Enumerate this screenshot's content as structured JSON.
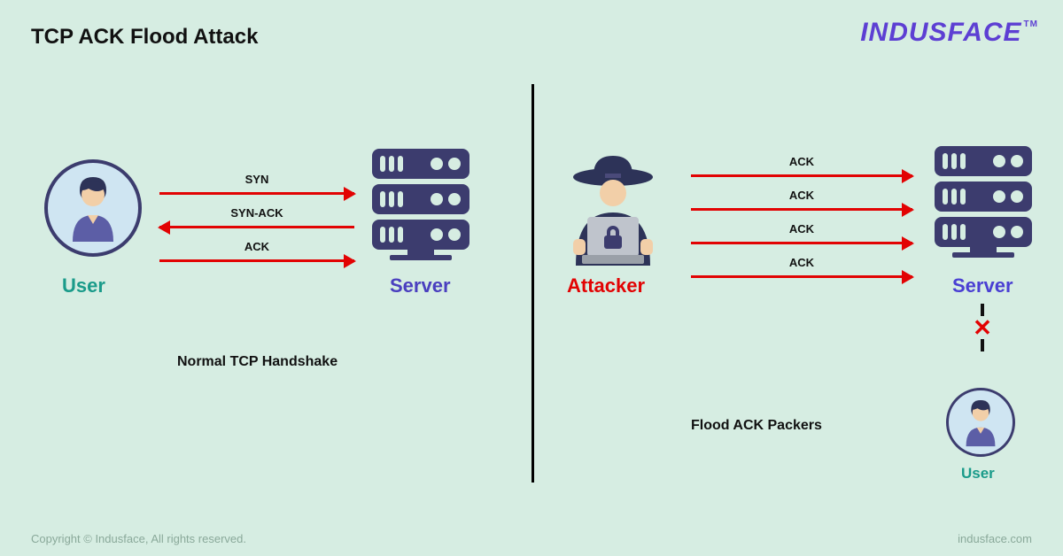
{
  "title": "TCP ACK Flood Attack",
  "brand": "INDUSFACE",
  "brand_tm": "TM",
  "left": {
    "user_label": "User",
    "server_label": "Server",
    "caption": "Normal TCP Handshake",
    "arrows": {
      "a1": "SYN",
      "a2": "SYN-ACK",
      "a3": "ACK"
    }
  },
  "right": {
    "attacker_label": "Attacker",
    "server_label": "Server",
    "caption": "Flood ACK Packers",
    "arrows": {
      "a1": "ACK",
      "a2": "ACK",
      "a3": "ACK",
      "a4": "ACK"
    },
    "blocked_user_label": "User"
  },
  "footer": {
    "copyright": "Copyright © Indusface, All rights reserved.",
    "site": "indusface.com"
  },
  "colors": {
    "bg": "#d6ede2",
    "arrow": "#e20303",
    "user": "#1a9b8a",
    "server": "#4a3fbf",
    "brand": "#5d3fd3",
    "attacker": "#e20303"
  }
}
